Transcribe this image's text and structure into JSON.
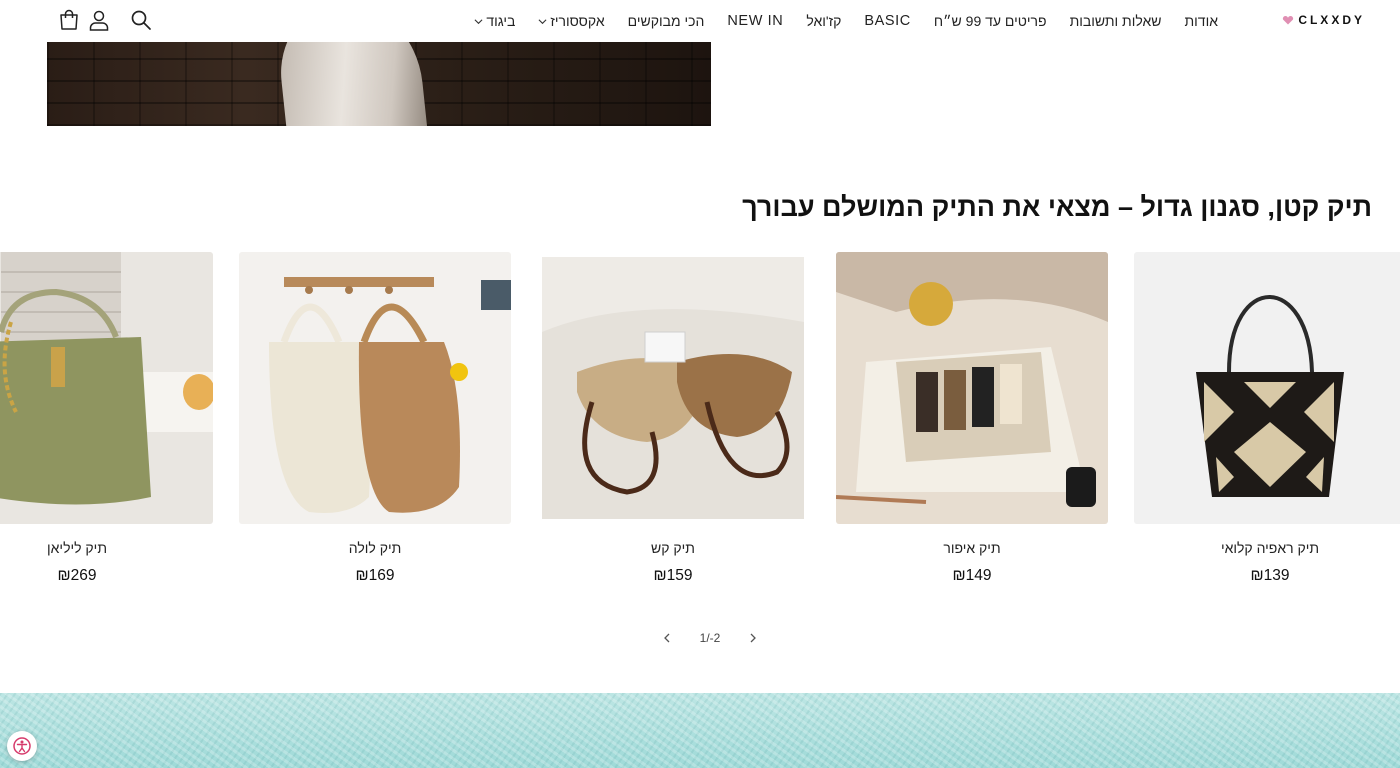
{
  "header": {
    "brand": "CLXXDY",
    "nav": [
      {
        "label": "ביגוד",
        "dropdown": true
      },
      {
        "label": "אקססוריז",
        "dropdown": true
      },
      {
        "label": "הכי מבוקשים",
        "dropdown": false
      },
      {
        "label": "NEW IN",
        "dropdown": false
      },
      {
        "label": "קז'ואל",
        "dropdown": false
      },
      {
        "label": "BASIC",
        "dropdown": false
      },
      {
        "label": "פריטים עד 99 ש״ח",
        "dropdown": false
      },
      {
        "label": "שאלות ותשובות",
        "dropdown": false
      },
      {
        "label": "אודות",
        "dropdown": false
      }
    ],
    "icons": [
      "search-icon",
      "account-icon",
      "cart-icon"
    ]
  },
  "section": {
    "title": "תיק קטן, סגנון גדול – מצאי את התיק המושלם עבורך",
    "products": [
      {
        "name": "תיק ראפיה קלואי",
        "price": "₪139"
      },
      {
        "name": "תיק איפור",
        "price": "₪149"
      },
      {
        "name": "תיק קש",
        "price": "₪159"
      },
      {
        "name": "תיק לולה",
        "price": "₪169"
      },
      {
        "name": "תיק ליליאן",
        "price": "₪269"
      }
    ],
    "pagination": {
      "current": "1",
      "total": "2",
      "label": "1/-2"
    }
  },
  "colors": {
    "accent_banner": "#a7ddda",
    "brand_mark": "#e08fb3",
    "text": "#1a1a1a"
  }
}
